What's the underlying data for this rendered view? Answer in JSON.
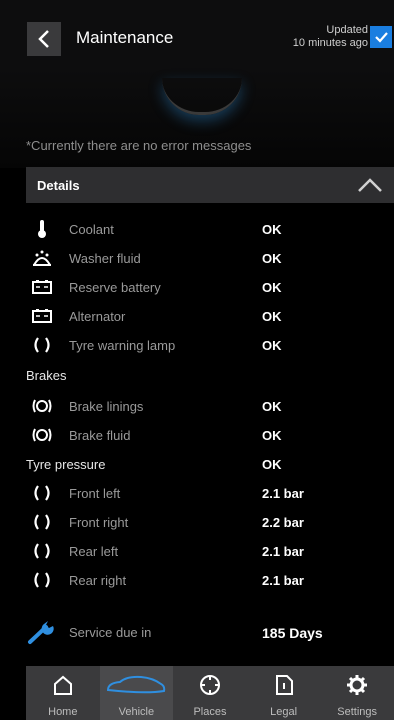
{
  "header": {
    "title": "Maintenance",
    "updated_line1": "Updated",
    "updated_line2": "10 minutes ago"
  },
  "error_message": "*Currently there are no error messages",
  "details": {
    "label": "Details",
    "rows": [
      {
        "icon": "thermometer-icon",
        "label": "Coolant",
        "value": "OK"
      },
      {
        "icon": "washer-fluid-icon",
        "label": "Washer fluid",
        "value": "OK"
      },
      {
        "icon": "battery-icon",
        "label": "Reserve battery",
        "value": "OK"
      },
      {
        "icon": "alternator-icon",
        "label": "Alternator",
        "value": "OK"
      },
      {
        "icon": "tyre-warning-icon",
        "label": "Tyre warning lamp",
        "value": "OK"
      }
    ]
  },
  "brakes": {
    "label": "Brakes",
    "rows": [
      {
        "icon": "brake-icon",
        "label": "Brake linings",
        "value": "OK"
      },
      {
        "icon": "brake-icon",
        "label": "Brake fluid",
        "value": "OK"
      }
    ]
  },
  "tyre_pressure": {
    "label": "Tyre pressure",
    "value": "OK",
    "rows": [
      {
        "icon": "tyre-icon",
        "label": "Front left",
        "value": "2.1 bar"
      },
      {
        "icon": "tyre-icon",
        "label": "Front right",
        "value": "2.2 bar"
      },
      {
        "icon": "tyre-icon",
        "label": "Rear left",
        "value": "2.1 bar"
      },
      {
        "icon": "tyre-icon",
        "label": "Rear right",
        "value": "2.1 bar"
      }
    ]
  },
  "service": {
    "icon": "wrench-icon",
    "label": "Service due in",
    "value": "185 Days"
  },
  "nav": {
    "items": [
      {
        "icon": "home-icon",
        "label": "Home"
      },
      {
        "icon": "car-icon",
        "label": "Vehicle",
        "active": true
      },
      {
        "icon": "compass-icon",
        "label": "Places"
      },
      {
        "icon": "document-icon",
        "label": "Legal"
      },
      {
        "icon": "gear-icon",
        "label": "Settings"
      }
    ]
  },
  "colors": {
    "accent": "#1a7ee0",
    "background": "#000000",
    "bar": "#2e2e30"
  }
}
